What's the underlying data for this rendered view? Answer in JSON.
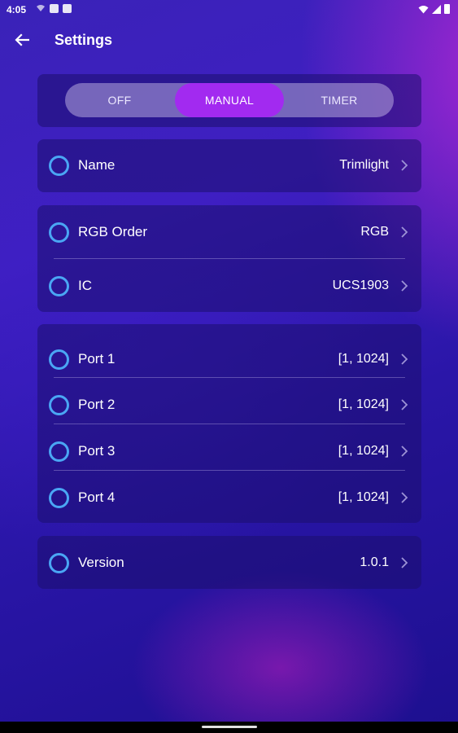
{
  "status_bar": {
    "time": "4:05"
  },
  "header": {
    "title": "Settings"
  },
  "mode": {
    "options": [
      "OFF",
      "MANUAL",
      "TIMER"
    ],
    "selected": "MANUAL"
  },
  "device": {
    "name_label": "Name",
    "name_value": "Trimlight"
  },
  "config": {
    "rgb_order_label": "RGB Order",
    "rgb_order_value": "RGB",
    "ic_label": "IC",
    "ic_value": "UCS1903"
  },
  "ports": [
    {
      "label": "Port 1",
      "value": "[1, 1024]"
    },
    {
      "label": "Port 2",
      "value": "[1, 1024]"
    },
    {
      "label": "Port 3",
      "value": "[1, 1024]"
    },
    {
      "label": "Port 4",
      "value": "[1, 1024]"
    }
  ],
  "version": {
    "label": "Version",
    "value": "1.0.1"
  },
  "colors": {
    "accent": "#a22af0",
    "ring": "#4aa6f4",
    "background_top": "#3f1fc2",
    "background_bottom": "#1d0f8f"
  },
  "icons": {
    "back": "arrow-left-icon",
    "row_indicator": "ring-icon",
    "row_chevron": "chevron-right-icon"
  }
}
